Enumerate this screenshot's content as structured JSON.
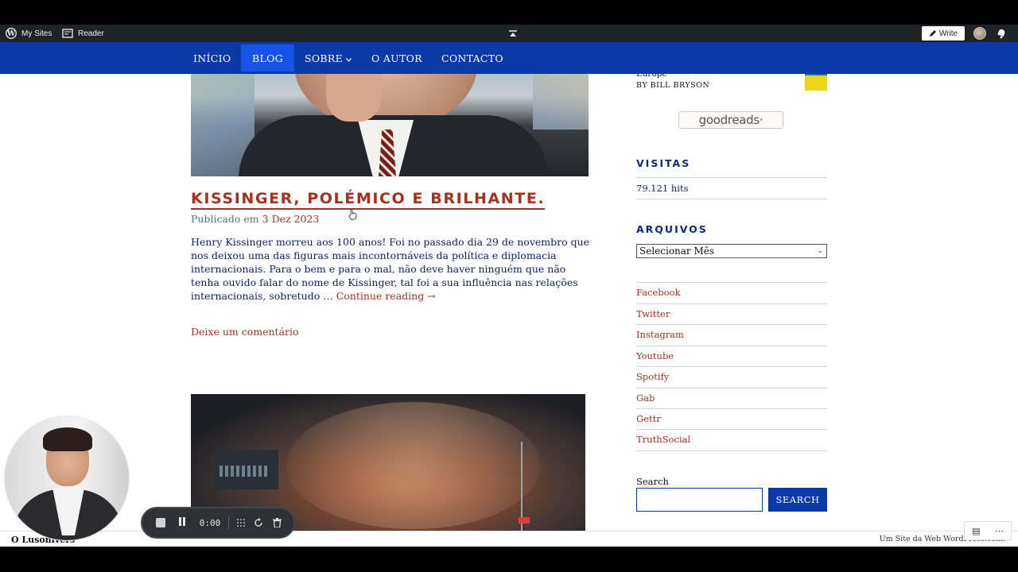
{
  "wp_bar": {
    "my_sites": "My Sites",
    "reader": "Reader",
    "write": "Write"
  },
  "nav": {
    "items": [
      {
        "label": "INÍCIO"
      },
      {
        "label": "BLOG",
        "active": true
      },
      {
        "label": "SOBRE"
      },
      {
        "label": "O AUTOR"
      },
      {
        "label": "CONTACTO"
      }
    ]
  },
  "post": {
    "title": "KISSINGER, POLÉMICO E BRILHANTE.",
    "meta_prefix": "Publicado em",
    "date": "3 Dez 2023",
    "excerpt": "Henry Kissinger morreu aos 100 anos! Foi no passado dia 29 de novembro que nos deixou uma das figuras mais incontornáveis da política e diplomacia internacionais. Para o bem e para o mal, não deve haver ninguém que não tenha ouvido falar do nome de Kissinger, tal foi a sua influência nas relações internacionais, sobretudo … ",
    "continue": "Continue reading →",
    "comment": "Deixe um comentário"
  },
  "sidebar": {
    "book_partial": "Europe",
    "book_author": "BY BILL BRYSON",
    "goodreads": "goodreads·",
    "visits_title": "VISITAS",
    "hits": "79.121 hits",
    "archives_title": "ARQUIVOS",
    "archives_select": "Selecionar Mês",
    "social": [
      "Facebook",
      "Twitter",
      "Instagram",
      "Youtube",
      "Spotify",
      "Gab",
      "Gettr",
      "TruthSocial"
    ],
    "search_label": "Search",
    "search_button": "SEARCH"
  },
  "footer": {
    "site_name": "O Lusonivers",
    "credit": "Um Site da Web WordPress.com."
  },
  "recorder": {
    "time": "0:00"
  },
  "colors": {
    "nav_bg": "#0a3aa8",
    "accent": "#a8301c",
    "text_blue": "#0e2466"
  }
}
